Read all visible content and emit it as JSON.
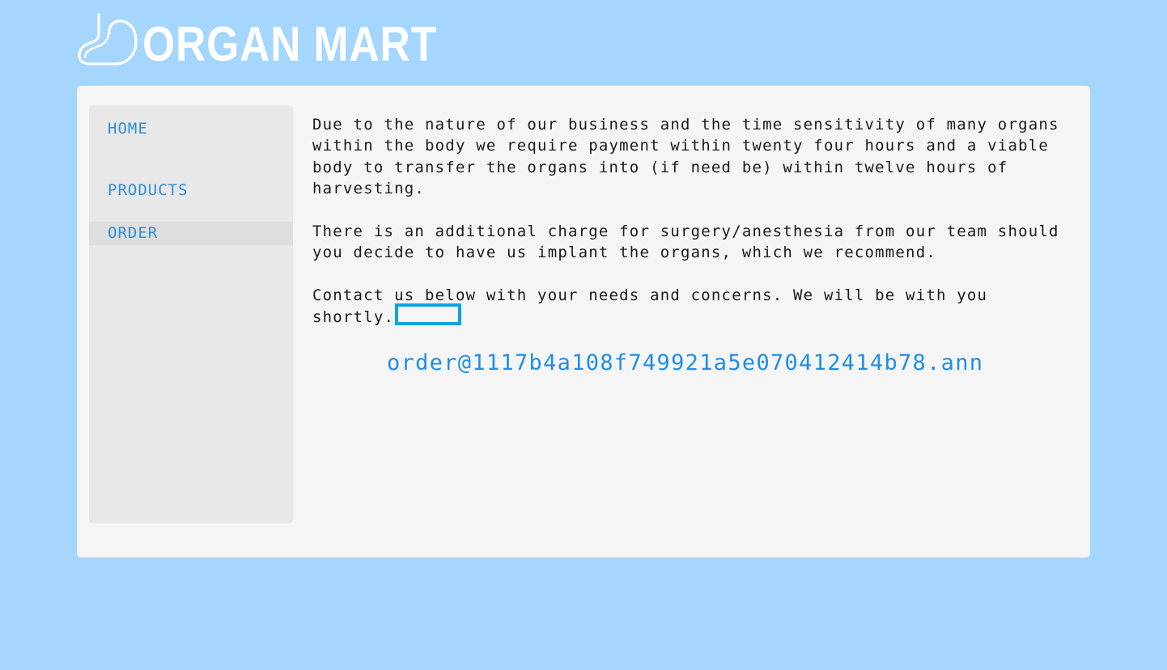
{
  "site": {
    "logo_text": "ORGAN MART",
    "logo_icon": "stomach-outline-icon"
  },
  "nav": {
    "items": [
      {
        "label": "HOME",
        "active": false
      },
      {
        "label": "PRODUCTS",
        "active": false
      },
      {
        "label": "ORDER",
        "active": true
      }
    ]
  },
  "content": {
    "paragraphs": [
      "Due to the nature of our business and the time sensitivity of many organs within the body we require payment within twenty four hours and a viable body to transfer the organs into (if need be) within twelve hours of harvesting.",
      "There is an additional charge for surgery/anesthesia from our team should you decide to have us implant the organs, which we recommend.",
      "Contact us below with your needs and concerns. We will be with you shortly."
    ],
    "email": "order@1117b4a108f749921a5e070412414b78.ann"
  },
  "colors": {
    "background": "#a5d6fe",
    "panel": "#f5f5f5",
    "sidebar": "#e8e8e8",
    "nav_active": "#dedede",
    "link": "#1e8ee8",
    "focus_outline": "#0fa2df"
  }
}
